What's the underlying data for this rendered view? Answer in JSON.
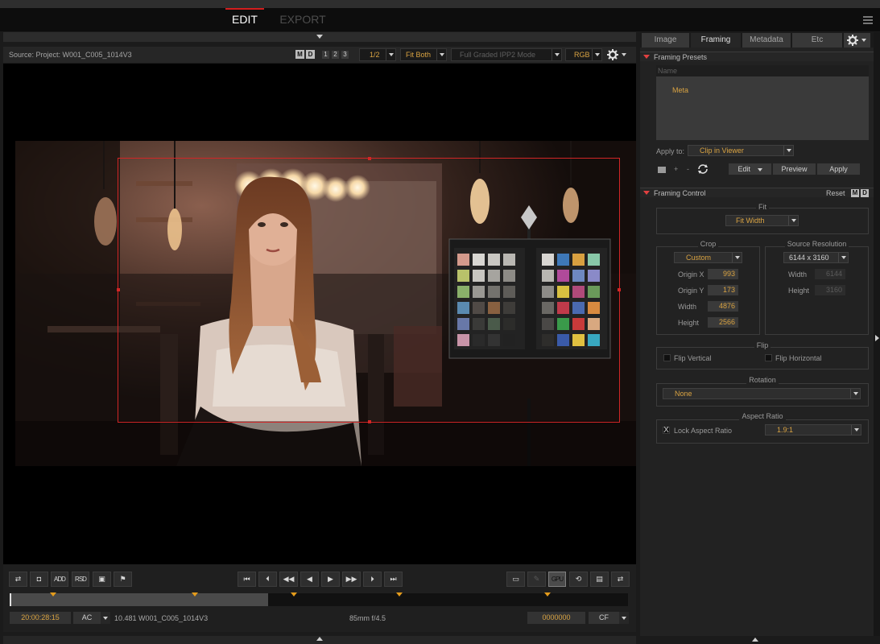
{
  "app": {
    "mode_tabs": {
      "edit": "EDIT",
      "export": "EXPORT"
    },
    "accent_color": "#d21d1d",
    "value_color": "#d9a342",
    "menu_icon": "hamburger-menu-icon"
  },
  "viewer_toolbar": {
    "source_label": "Source: Project: W001_C005_1014V3",
    "mode_buttons": [
      "M",
      "D"
    ],
    "number_buttons": [
      "1",
      "2",
      "3"
    ],
    "resolution": "1/2",
    "fit": "Fit Both",
    "color_mode": "Full Graded IPP2 Mode",
    "channel": "RGB",
    "settings_icon": "gear-icon"
  },
  "transport": {
    "left_tools": [
      {
        "name": "sync-toggle-button",
        "glyph": "⇄"
      },
      {
        "name": "snapshot-button",
        "glyph": "◘"
      },
      {
        "name": "snapshot-add-button",
        "glyph": "ADD"
      },
      {
        "name": "snapshot-rsd-button",
        "glyph": "RSD"
      },
      {
        "name": "image-view-button",
        "glyph": "▣"
      },
      {
        "name": "flag-button",
        "glyph": "⚑"
      }
    ],
    "playback": [
      {
        "name": "go-to-start-button",
        "glyph": "⏮"
      },
      {
        "name": "previous-mark-button",
        "glyph": "⏴"
      },
      {
        "name": "rewind-button",
        "glyph": "◀◀"
      },
      {
        "name": "step-back-button",
        "glyph": "◀"
      },
      {
        "name": "play-button",
        "glyph": "▶"
      },
      {
        "name": "fast-forward-button",
        "glyph": "▶▶"
      },
      {
        "name": "next-mark-button",
        "glyph": "⏵"
      },
      {
        "name": "go-to-end-button",
        "glyph": "⏭"
      }
    ],
    "right_tools": [
      {
        "name": "monitor-button",
        "glyph": "▭"
      },
      {
        "name": "pin-button",
        "glyph": "✎"
      },
      {
        "name": "gpu-button",
        "glyph": "GPU"
      },
      {
        "name": "loop-button",
        "glyph": "⟲"
      },
      {
        "name": "clip-strip-button",
        "glyph": "▤"
      },
      {
        "name": "sync-out-button",
        "glyph": "⇄"
      }
    ],
    "timecode": "20:00:28:15",
    "timecode_mode": "AC",
    "clip_info": "10.481 W001_C005_1014V3",
    "lens_info": "85mm  f/4.5",
    "frame_count": "0000000",
    "frame_mode": "CF",
    "playhead_fraction": 0.415,
    "markers": [
      0.07,
      0.3,
      0.46,
      0.63,
      0.87
    ]
  },
  "panel": {
    "tabs": [
      "Image",
      "Framing",
      "Metadata",
      "Etc"
    ],
    "active_tab": "Framing",
    "settings_icon": "gear-icon",
    "presets": {
      "title": "Framing Presets",
      "column_header": "Name",
      "items": [
        "Meta"
      ],
      "apply_to_label": "Apply to:",
      "apply_to_value": "Clip in Viewer",
      "buttons": {
        "edit": "Edit",
        "preview": "Preview",
        "apply": "Apply"
      },
      "add_glyph": "+",
      "remove_glyph": "-"
    },
    "control": {
      "title": "Framing Control",
      "reset": "Reset",
      "mode_buttons": [
        "M",
        "D"
      ],
      "fit": {
        "label": "Fit",
        "value": "Fit Width"
      },
      "crop": {
        "label": "Crop",
        "mode": "Custom",
        "fields": [
          {
            "label": "Origin X",
            "value": "993"
          },
          {
            "label": "Origin Y",
            "value": "173"
          },
          {
            "label": "Width",
            "value": "4876"
          },
          {
            "label": "Height",
            "value": "2566"
          }
        ]
      },
      "source_resolution": {
        "label": "Source Resolution",
        "value": "6144 x 3160",
        "fields": [
          {
            "label": "Width",
            "value": "6144"
          },
          {
            "label": "Height",
            "value": "3160"
          }
        ]
      },
      "flip": {
        "label": "Flip",
        "vertical": "Flip Vertical",
        "horizontal": "Flip Horizontal"
      },
      "rotation": {
        "label": "Rotation",
        "value": "None"
      },
      "aspect_ratio": {
        "label": "Aspect Ratio",
        "lock_label": "Lock Aspect Ratio",
        "lock_mark": "X",
        "value": "1.9:1"
      }
    }
  }
}
